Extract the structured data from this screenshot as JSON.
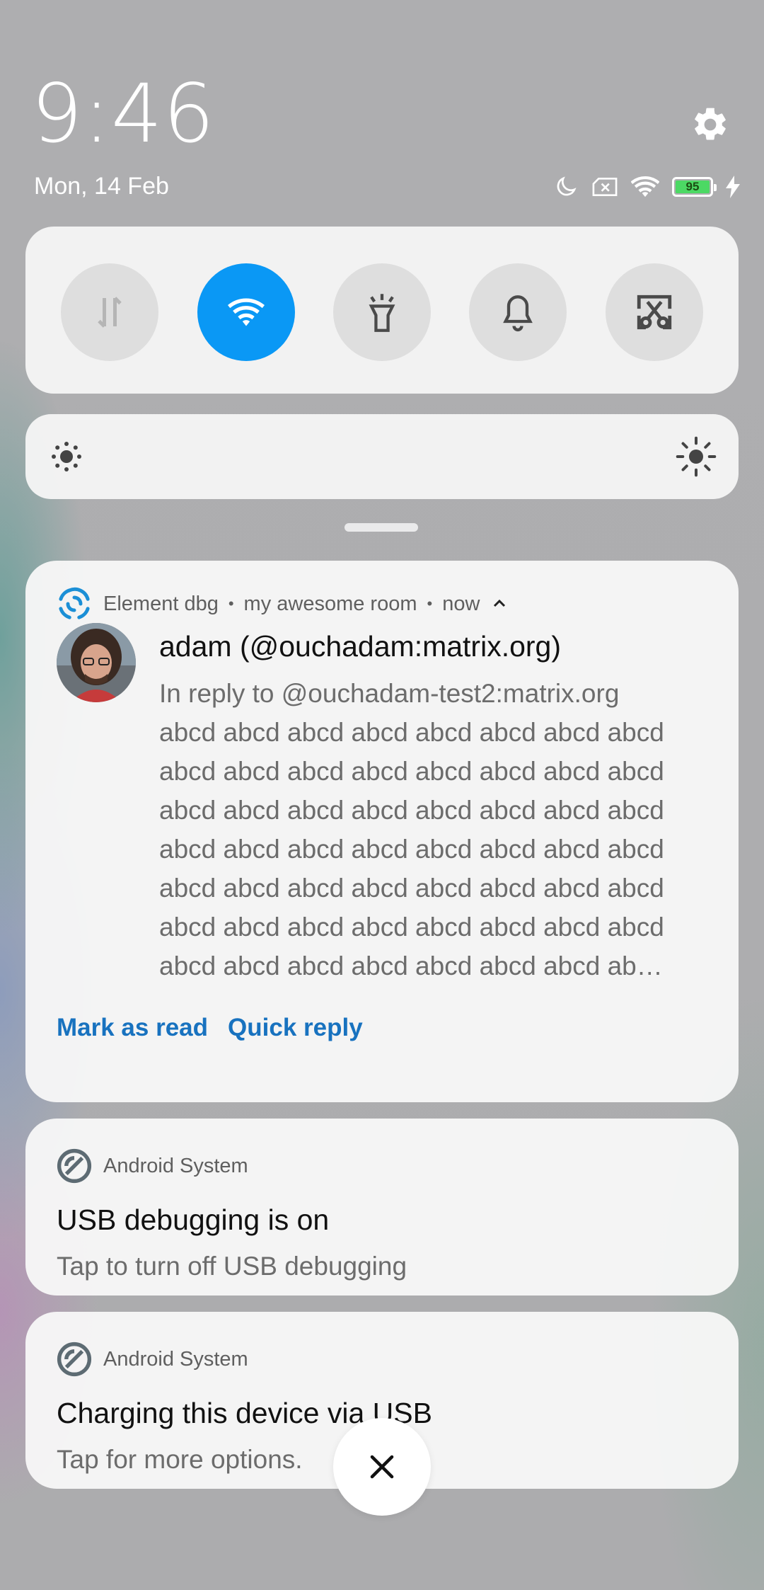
{
  "status": {
    "time": "9:46",
    "date": "Mon, 14 Feb",
    "battery_level": "95",
    "icons": [
      "moon-icon",
      "no-sim-icon",
      "wifi-icon",
      "battery-icon",
      "charging-bolt-icon"
    ]
  },
  "quick_settings": {
    "tiles": [
      {
        "name": "mobile-data",
        "icon": "data-arrows-icon",
        "active": false
      },
      {
        "name": "wifi",
        "icon": "wifi-icon",
        "active": true
      },
      {
        "name": "flashlight",
        "icon": "flashlight-icon",
        "active": false
      },
      {
        "name": "sound",
        "icon": "bell-icon",
        "active": false
      },
      {
        "name": "screenshot",
        "icon": "scissors-icon",
        "active": false
      }
    ],
    "accent_color": "#0a98f5"
  },
  "brightness": {
    "min_icon": "brightness-low-icon",
    "max_icon": "brightness-high-icon"
  },
  "notifications": [
    {
      "app": "Element dbg",
      "room": "my awesome room",
      "time": "now",
      "sender": "adam (@ouchadam:matrix.org)",
      "message_lines": [
        "In reply to @ouchadam-test2:matrix.org",
        "abcd abcd abcd abcd abcd abcd abcd abcd",
        "abcd abcd abcd abcd abcd abcd abcd abcd",
        "abcd abcd abcd abcd abcd abcd abcd abcd",
        "abcd abcd abcd abcd abcd abcd abcd abcd",
        "abcd abcd abcd abcd abcd abcd abcd abcd",
        "abcd abcd abcd abcd abcd abcd abcd abcd",
        "abcd abcd abcd abcd abcd abcd abcd ab…"
      ],
      "actions": [
        "Mark as read",
        "Quick reply"
      ]
    },
    {
      "app": "Android System",
      "title": "USB debugging is on",
      "text": "Tap to turn off USB debugging"
    },
    {
      "app": "Android System",
      "title": "Charging this device via USB",
      "text": "Tap for more options."
    }
  ]
}
